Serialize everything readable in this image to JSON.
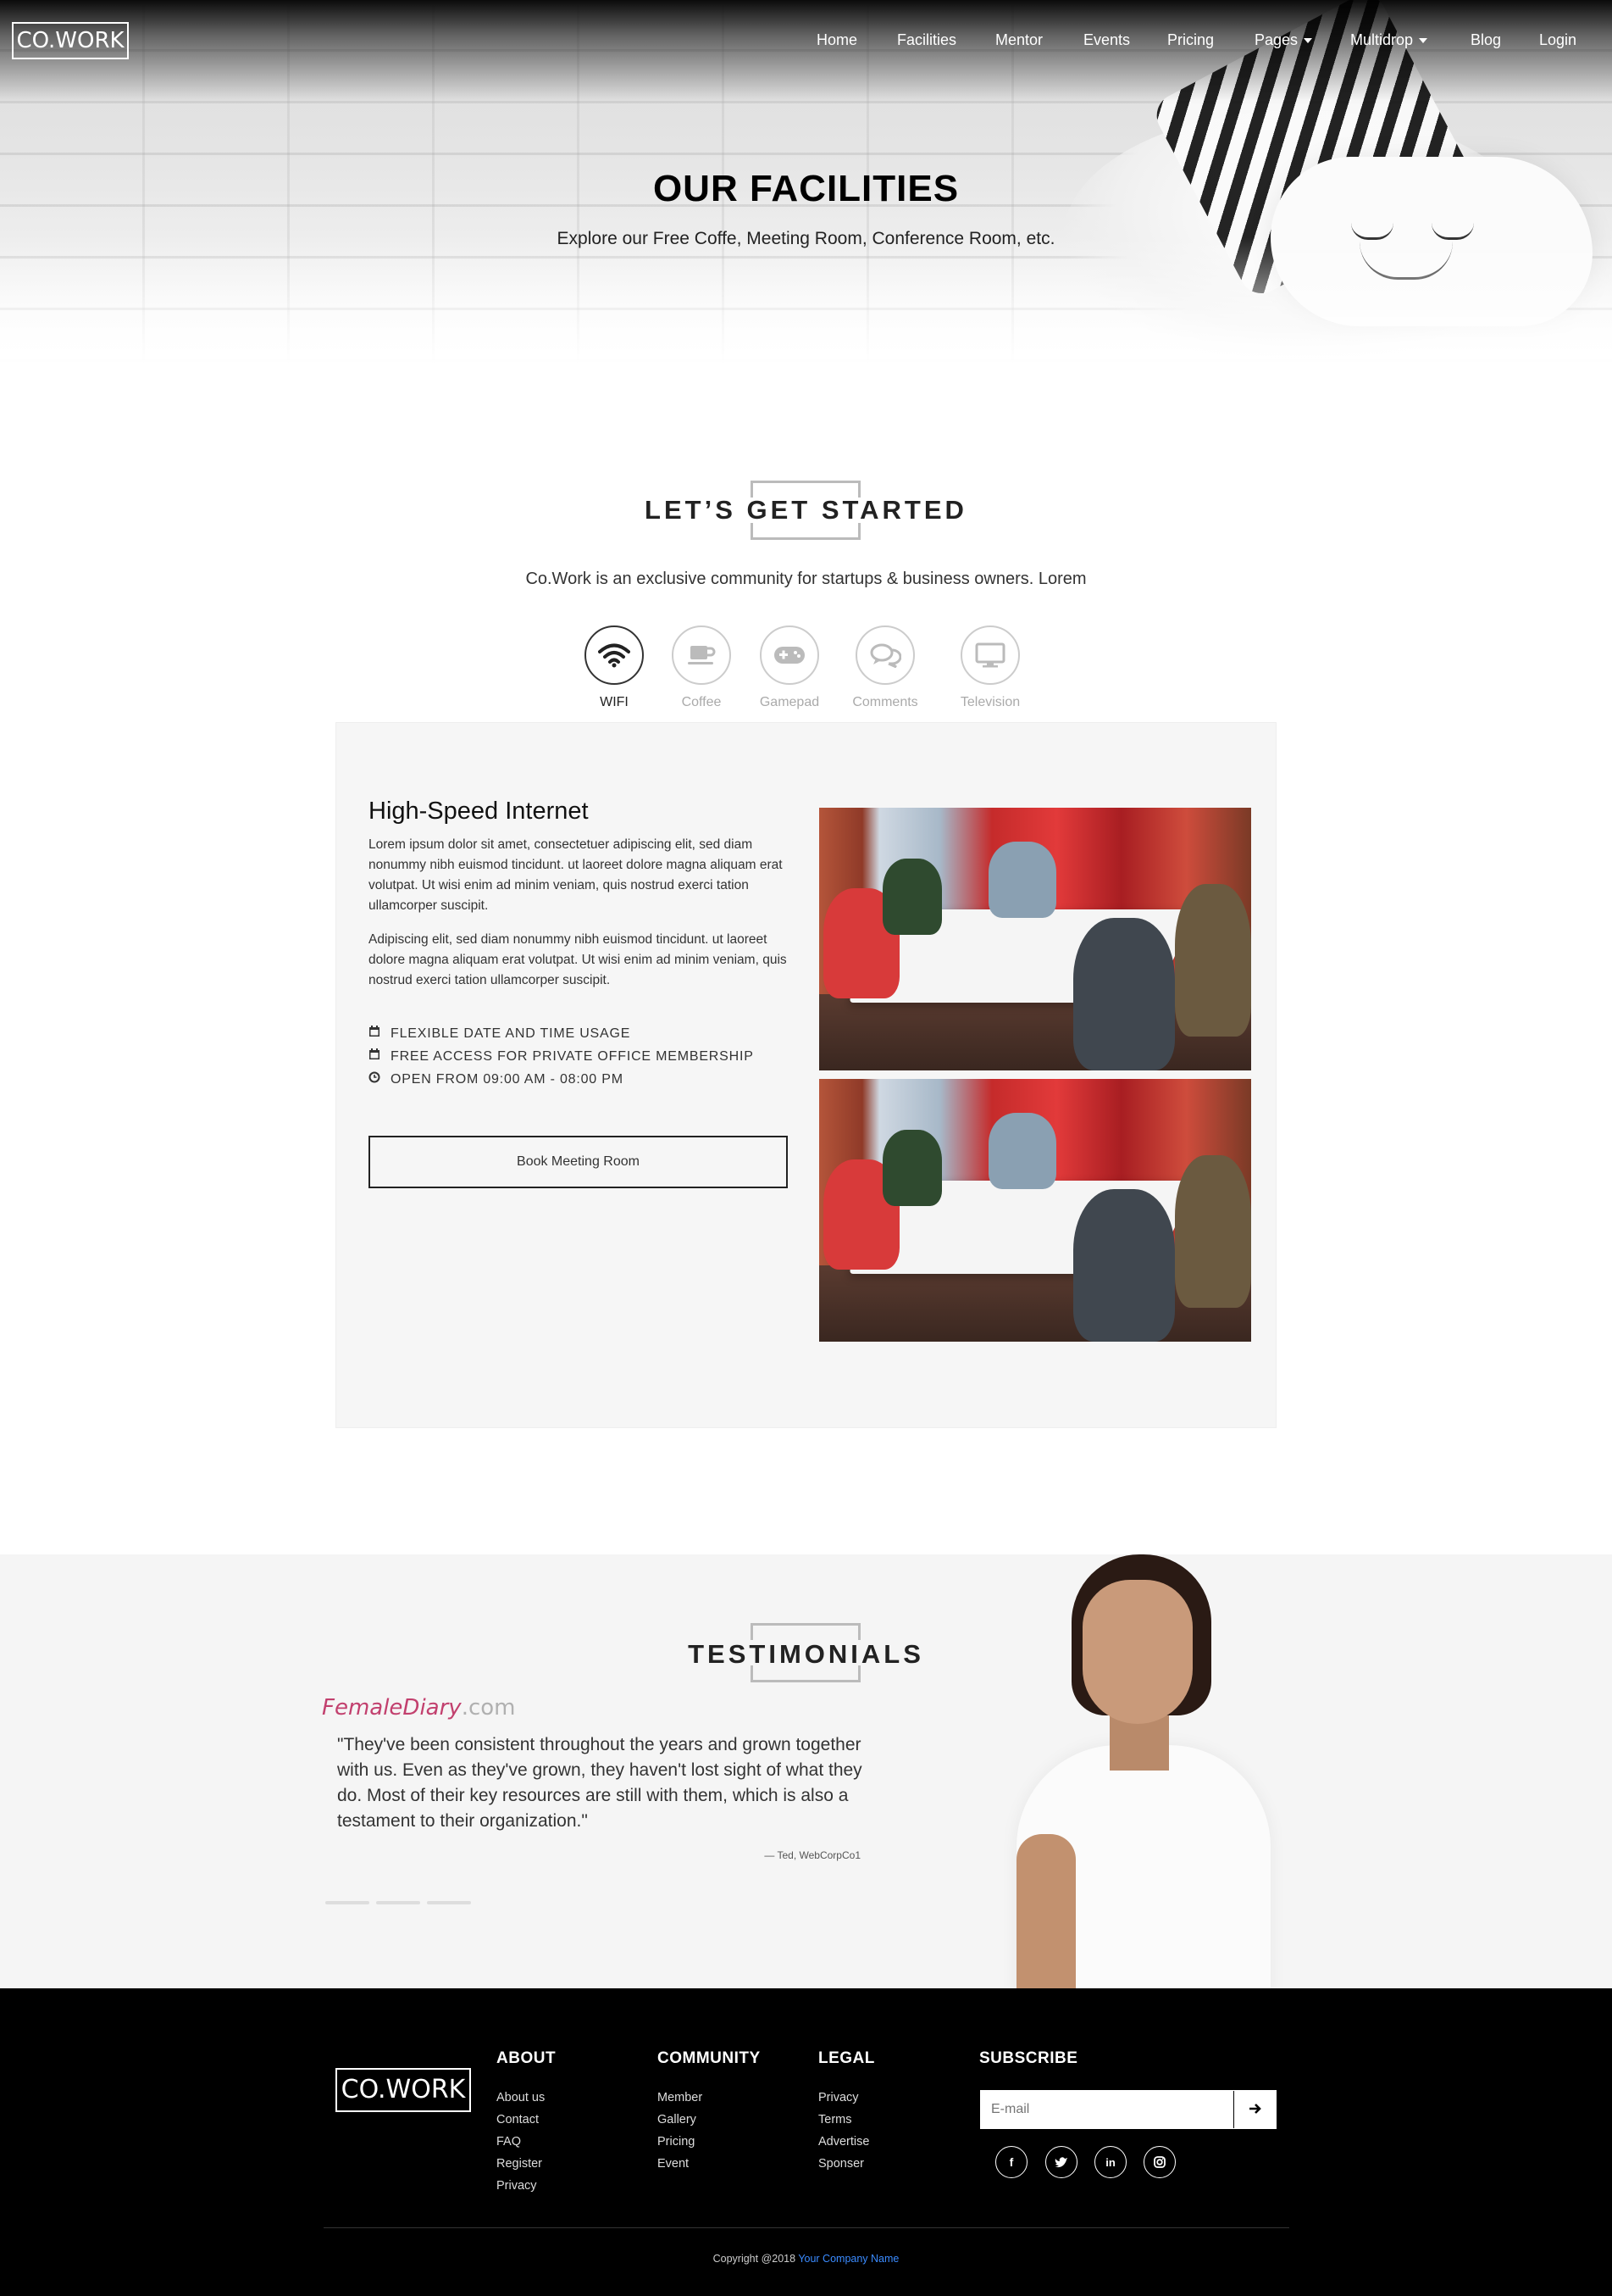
{
  "header": {
    "logo": "CO.WORK",
    "nav": [
      "Home",
      "Facilities",
      "Mentor",
      "Events",
      "Pricing",
      "Pages",
      "Multidrop",
      "Blog",
      "Login"
    ]
  },
  "hero": {
    "title": "OUR FACILITIES",
    "subtitle": "Explore our Free Coffe, Meeting Room, Conference Room, etc."
  },
  "started": {
    "title": "LET’S GET STARTED",
    "intro": "Co.Work is an exclusive community for startups & business owners. Lorem"
  },
  "facilities": [
    {
      "label": "WIFI",
      "icon": "wifi-icon",
      "active": true
    },
    {
      "label": "Coffee",
      "icon": "coffee-icon",
      "active": false
    },
    {
      "label": "Gamepad",
      "icon": "gamepad-icon",
      "active": false
    },
    {
      "label": "Comments",
      "icon": "comments-icon",
      "active": false
    },
    {
      "label": "Television",
      "icon": "television-icon",
      "active": false
    }
  ],
  "panel": {
    "title": "High-Speed Internet",
    "para1": "Lorem ipsum dolor sit amet, consectetuer adipiscing elit, sed diam nonummy nibh euismod tincidunt. ut laoreet dolore magna aliquam erat volutpat. Ut wisi enim ad minim veniam, quis nostrud exerci tation ullamcorper suscipit.",
    "para2": "Adipiscing elit, sed diam nonummy nibh euismod tincidunt. ut laoreet dolore magna aliquam erat volutpat. Ut wisi enim ad minim veniam, quis nostrud exerci tation ullamcorper suscipit.",
    "features": [
      "FLEXIBLE DATE AND TIME USAGE",
      "FREE ACCESS FOR PRIVATE OFFICE MEMBERSHIP",
      "OPEN FROM 09:00 AM - 08:00 PM"
    ],
    "button": "Book Meeting Room"
  },
  "testimonials": {
    "title": "TESTIMONIALS",
    "brand_main": "FemaleDiary",
    "brand_suffix": ".com",
    "quote": "\"They've been consistent throughout the years and grown together with us. Even as they've grown, they haven't lost sight of what they do. Most of their key resources are still with them, which is also a testament to their organization.\"",
    "author": "— Ted, WebCorpCo1"
  },
  "footer": {
    "logo": "CO.WORK",
    "about": {
      "title": "ABOUT",
      "links": [
        "About us",
        "Contact",
        "FAQ",
        "Register",
        "Privacy"
      ]
    },
    "community": {
      "title": "COMMUNITY",
      "links": [
        "Member",
        "Gallery",
        "Pricing",
        "Event"
      ]
    },
    "legal": {
      "title": "LEGAL",
      "links": [
        "Privacy",
        "Terms",
        "Advertise",
        "Sponser"
      ]
    },
    "subscribe": {
      "title": "SUBSCRIBE",
      "placeholder": "E-mail"
    },
    "social": [
      "facebook-icon",
      "twitter-icon",
      "linkedin-icon",
      "instagram-icon"
    ],
    "copyright_prefix": "Copyright @2018",
    "copyright_link": "Your Company Name"
  }
}
